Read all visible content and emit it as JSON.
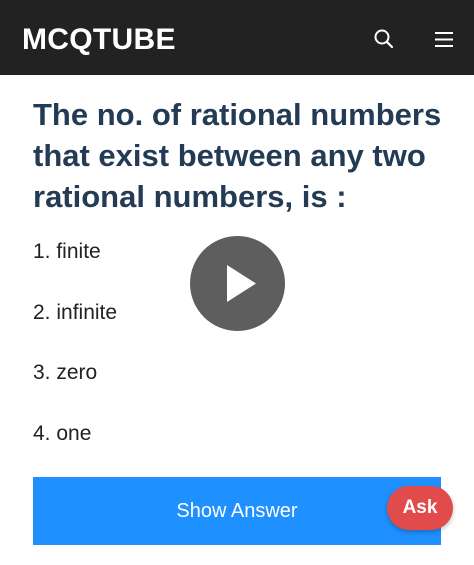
{
  "header": {
    "logo": "MCQTUBE",
    "background": "#222222",
    "icons": [
      "search-icon",
      "menu-icon"
    ]
  },
  "question": {
    "text": "The no. of rational numbers that exist between any two rational numbers, is :",
    "color": "#243b55"
  },
  "options": [
    {
      "label": "1. finite"
    },
    {
      "label": "2. infinite"
    },
    {
      "label": "3. zero"
    },
    {
      "label": "4. one"
    }
  ],
  "video": {
    "icon": "play-icon"
  },
  "show_answer": {
    "label": "Show Answer",
    "color": "#1e90ff"
  },
  "ask": {
    "label": "Ask",
    "color": "#e24b4b"
  }
}
